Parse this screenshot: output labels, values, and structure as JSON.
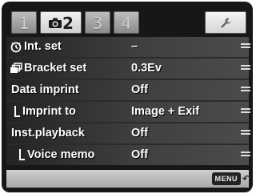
{
  "tabs": [
    {
      "label": "1"
    },
    {
      "label": "2"
    },
    {
      "label": "3"
    },
    {
      "label": "4"
    }
  ],
  "menu": {
    "items": [
      {
        "label": "Int. set",
        "value": "–"
      },
      {
        "label": "Bracket set",
        "value": "0.3Ev"
      },
      {
        "label": "Data imprint",
        "value": "Off"
      },
      {
        "label": "Imprint to",
        "value": "Image + Exif"
      },
      {
        "label": "Inst.playback",
        "value": "Off"
      },
      {
        "label": "Voice memo",
        "value": "Off"
      }
    ]
  },
  "footer": {
    "menu_button": "MENU"
  },
  "colors": {
    "background": "#17171a",
    "text": "#ffffff",
    "active_tab": "#e6e6e6"
  }
}
